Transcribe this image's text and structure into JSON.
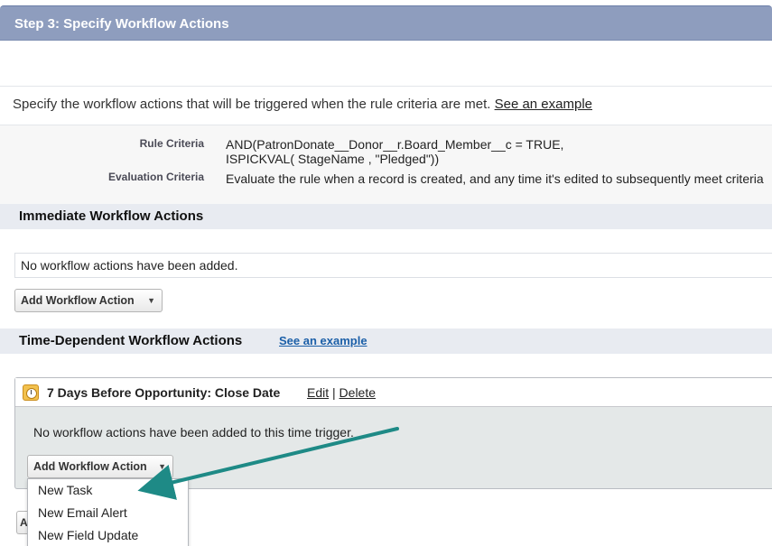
{
  "step_header": {
    "title": "Step 3: Specify Workflow Actions"
  },
  "intro": {
    "text": "Specify the workflow actions that will be triggered when the rule criteria are met.",
    "link": "See an example"
  },
  "criteria": {
    "rule_label": "Rule Criteria",
    "rule_value_line1": "AND(PatronDonate__Donor__r.Board_Member__c = TRUE,",
    "rule_value_line2": "ISPICKVAL( StageName , \"Pledged\"))",
    "eval_label": "Evaluation Criteria",
    "eval_value": "Evaluate the rule when a record is created, and any time it's edited to subsequently meet criteria"
  },
  "immediate": {
    "title": "Immediate Workflow Actions",
    "empty_text": "No workflow actions have been added.",
    "add_button": "Add Workflow Action"
  },
  "time_dependent": {
    "title": "Time-Dependent Workflow Actions",
    "link": "See an example",
    "trigger": {
      "title": "7 Days Before Opportunity: Close Date",
      "edit": "Edit",
      "separator": "|",
      "delete": "Delete",
      "empty_text": "No workflow actions have been added to this time trigger.",
      "add_button": "Add Workflow Action"
    },
    "peek_button": "A"
  },
  "dropdown": {
    "items": [
      "New Task",
      "New Email Alert",
      "New Field Update"
    ]
  },
  "colors": {
    "header_bg": "#8e9dbe",
    "section_bg": "#e8ebf1",
    "link_blue": "#1b5fa8",
    "arrow_teal": "#1e8a86"
  },
  "icons": {
    "button_caret": "▼"
  }
}
